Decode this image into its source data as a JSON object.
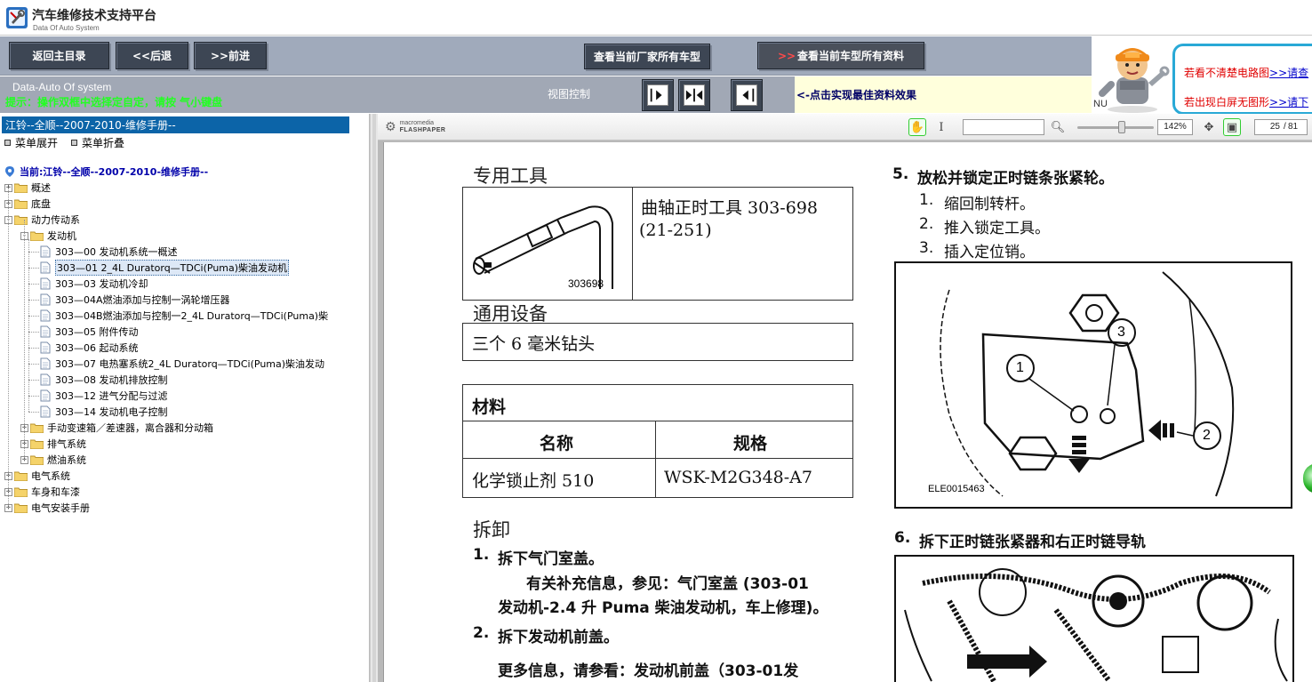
{
  "app": {
    "title": "汽车维修技术支持平台",
    "subtitle": "Data Of Auto System"
  },
  "toolbar": {
    "home": "返回主目录",
    "back": "<<后退",
    "forward": ">>前进",
    "all_models": "查看当前厂家所有车型",
    "model_docs_arrow": ">>",
    "model_docs": "查看当前车型所有资料"
  },
  "help": {
    "line1_text": "若看不清楚电路图",
    "line1_link": ">>请查",
    "line2_text": "若出现白屏无图形",
    "line2_link": ">>请下",
    "nu": "NU"
  },
  "status": {
    "site_name": "Data-Auto Of system",
    "notice": "提示：操作双框中选择定自定，请按  气小键盘",
    "view_label": "视图控制",
    "view_hint": "<-点击实现最佳资料效果"
  },
  "tree": {
    "header": "江铃--全顺--2007-2010-维修手册--",
    "expand": "菜单展开",
    "collapse": "菜单折叠",
    "current": "当前:江铃--全顺--2007-2010-维修手册--",
    "nodes": [
      {
        "label": "概述",
        "type": "folder",
        "level": 0,
        "pm": "+"
      },
      {
        "label": "底盘",
        "type": "folder",
        "level": 0,
        "pm": "+"
      },
      {
        "label": "动力传动系",
        "type": "folder",
        "level": 0,
        "pm": "-"
      },
      {
        "label": "发动机",
        "type": "folder",
        "level": 1,
        "pm": "-"
      },
      {
        "label": "303—00 发动机系统一概述",
        "type": "doc",
        "level": 2
      },
      {
        "label": "303—01 2_4L Duratorq—TDCi(Puma)柴油发动机",
        "type": "doc",
        "level": 2,
        "selected": true
      },
      {
        "label": "303—03 发动机冷却",
        "type": "doc",
        "level": 2
      },
      {
        "label": "303—04A燃油添加与控制一涡轮增压器",
        "type": "doc",
        "level": 2
      },
      {
        "label": "303—04B燃油添加与控制一2_4L Duratorq—TDCi(Puma)柴",
        "type": "doc",
        "level": 2
      },
      {
        "label": "303—05 附件传动",
        "type": "doc",
        "level": 2
      },
      {
        "label": "303—06 起动系统",
        "type": "doc",
        "level": 2
      },
      {
        "label": "303—07 电热塞系统2_4L Duratorq—TDCi(Puma)柴油发动",
        "type": "doc",
        "level": 2
      },
      {
        "label": "303—08 发动机排放控制",
        "type": "doc",
        "level": 2
      },
      {
        "label": "303—12 进气分配与过滤",
        "type": "doc",
        "level": 2
      },
      {
        "label": "303—14 发动机电子控制",
        "type": "doc",
        "level": 2
      },
      {
        "label": "手动变速箱／差速器，离合器和分动箱",
        "type": "folder",
        "level": 1,
        "pm": "+"
      },
      {
        "label": "排气系统",
        "type": "folder",
        "level": 1,
        "pm": "+"
      },
      {
        "label": "燃油系统",
        "type": "folder",
        "level": 1,
        "pm": "+"
      },
      {
        "label": "电气系统",
        "type": "folder",
        "level": 0,
        "pm": "+"
      },
      {
        "label": "车身和车漆",
        "type": "folder",
        "level": 0,
        "pm": "+"
      },
      {
        "label": "电气安装手册",
        "type": "folder",
        "level": 0,
        "pm": "+"
      }
    ]
  },
  "viewer": {
    "brand_small": "macromedia",
    "brand": "FLASHPAPER",
    "zoom": "142%",
    "page_current": "25",
    "page_total": "81"
  },
  "doc": {
    "special_tools_title": "专用工具",
    "tool_code": "303698",
    "tool_name": "曲轴正时工具 303-698",
    "tool_ref": "(21-251)",
    "general_equipment_title": "通用设备",
    "general_equipment": "三个 6 毫米钻头",
    "materials_title": "材料",
    "mat_col_name": "名称",
    "mat_col_spec": "规格",
    "mat_name": "化学锁止剂 510",
    "mat_spec": "WSK-M2G348-A7",
    "removal_title": "拆卸",
    "step1_num": "1.",
    "step1": "拆下气门室盖。",
    "step1_info_a": "有关补充信息，参见：气门室盖 (303-01",
    "step1_info_b": "发动机-2.4 升 Puma 柴油发动机，车上修理)。",
    "step2_num": "2.",
    "step2": "拆下发动机前盖。",
    "step2_info": "更多信息，请参看：发动机前盖（303-01发",
    "step5_num": "5.",
    "step5": "放松并锁定正时链条张紧轮。",
    "step5_subs": [
      {
        "num": "1.",
        "text": "缩回制转杆。"
      },
      {
        "num": "2.",
        "text": "推入锁定工具。"
      },
      {
        "num": "3.",
        "text": "插入定位销。"
      }
    ],
    "figure1_code": "ELE0015463",
    "figure1_callouts": [
      "1",
      "2",
      "3"
    ],
    "step6_num": "6.",
    "step6": "拆下正时链张紧器和右正时链导轨"
  }
}
